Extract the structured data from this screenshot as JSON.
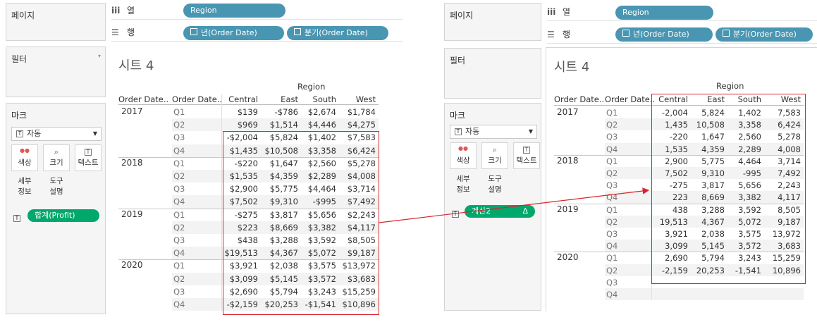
{
  "left": {
    "pages_label": "페이지",
    "filters_label": "필터",
    "marks_label": "마크",
    "columns_label": "열",
    "rows_label": "행",
    "columns_pill": "Region",
    "row_pills": [
      "년(Order Date)",
      "분기(Order Date)"
    ],
    "mark_type": "자동",
    "mark_buttons": [
      {
        "icon": "color-dots-icon",
        "label": "색상"
      },
      {
        "icon": "size-icon",
        "label": "크기"
      },
      {
        "icon": "text-icon",
        "label": "텍스트"
      },
      {
        "icon": "detail-icon",
        "label": "세부\n정보"
      },
      {
        "icon": "tooltip-icon",
        "label": "도구\n설명"
      }
    ],
    "mark_pill": "합계(Profit)",
    "sheet_title": "시트 4",
    "header": {
      "region": "Region",
      "col1": "Order Date..",
      "col2": "Order Date..",
      "regions": [
        "Central",
        "East",
        "South",
        "West"
      ]
    },
    "rows": [
      {
        "year": "2017",
        "q": "Q1",
        "v": [
          "$139",
          "-$786",
          "$2,674",
          "$1,784"
        ]
      },
      {
        "year": "",
        "q": "Q2",
        "v": [
          "$969",
          "$1,514",
          "$4,446",
          "$4,275"
        ]
      },
      {
        "year": "",
        "q": "Q3",
        "v": [
          "-$2,004",
          "$5,824",
          "$1,402",
          "$7,583"
        ]
      },
      {
        "year": "",
        "q": "Q4",
        "v": [
          "$1,435",
          "$10,508",
          "$3,358",
          "$6,424"
        ]
      },
      {
        "year": "2018",
        "q": "Q1",
        "v": [
          "-$220",
          "$1,647",
          "$2,560",
          "$5,278"
        ]
      },
      {
        "year": "",
        "q": "Q2",
        "v": [
          "$1,535",
          "$4,359",
          "$2,289",
          "$4,008"
        ]
      },
      {
        "year": "",
        "q": "Q3",
        "v": [
          "$2,900",
          "$5,775",
          "$4,464",
          "$3,714"
        ]
      },
      {
        "year": "",
        "q": "Q4",
        "v": [
          "$7,502",
          "$9,310",
          "-$995",
          "$7,492"
        ]
      },
      {
        "year": "2019",
        "q": "Q1",
        "v": [
          "-$275",
          "$3,817",
          "$5,656",
          "$2,243"
        ]
      },
      {
        "year": "",
        "q": "Q2",
        "v": [
          "$223",
          "$8,669",
          "$3,382",
          "$4,117"
        ]
      },
      {
        "year": "",
        "q": "Q3",
        "v": [
          "$438",
          "$3,288",
          "$3,592",
          "$8,505"
        ]
      },
      {
        "year": "",
        "q": "Q4",
        "v": [
          "$19,513",
          "$4,367",
          "$5,072",
          "$9,187"
        ]
      },
      {
        "year": "2020",
        "q": "Q1",
        "v": [
          "$3,921",
          "$2,038",
          "$3,575",
          "$13,972"
        ]
      },
      {
        "year": "",
        "q": "Q2",
        "v": [
          "$3,099",
          "$5,145",
          "$3,572",
          "$3,683"
        ]
      },
      {
        "year": "",
        "q": "Q3",
        "v": [
          "$2,690",
          "$5,794",
          "$3,243",
          "$15,259"
        ]
      },
      {
        "year": "",
        "q": "Q4",
        "v": [
          "-$2,159",
          "$20,253",
          "-$1,541",
          "$10,896"
        ]
      }
    ]
  },
  "right": {
    "pages_label": "페이지",
    "filters_label": "필터",
    "marks_label": "마크",
    "columns_label": "열",
    "rows_label": "행",
    "columns_pill": "Region",
    "row_pills": [
      "년(Order Date)",
      "분기(Order Date)"
    ],
    "mark_type": "자동",
    "mark_buttons": [
      {
        "icon": "color-dots-icon",
        "label": "색상"
      },
      {
        "icon": "size-icon",
        "label": "크기"
      },
      {
        "icon": "text-icon",
        "label": "텍스트"
      },
      {
        "icon": "detail-icon",
        "label": "세부\n정보"
      },
      {
        "icon": "tooltip-icon",
        "label": "도구\n설명"
      }
    ],
    "mark_pill": "계산2",
    "mark_pill_delta": "Δ",
    "sheet_title": "시트 4",
    "header": {
      "region": "Region",
      "col1": "Order Date..",
      "col2": "Order Date..",
      "regions": [
        "Central",
        "East",
        "South",
        "West"
      ]
    },
    "rows": [
      {
        "year": "2017",
        "q": "Q1",
        "v": [
          "-2,004",
          "5,824",
          "1,402",
          "7,583"
        ]
      },
      {
        "year": "",
        "q": "Q2",
        "v": [
          "1,435",
          "10,508",
          "3,358",
          "6,424"
        ]
      },
      {
        "year": "",
        "q": "Q3",
        "v": [
          "-220",
          "1,647",
          "2,560",
          "5,278"
        ]
      },
      {
        "year": "",
        "q": "Q4",
        "v": [
          "1,535",
          "4,359",
          "2,289",
          "4,008"
        ]
      },
      {
        "year": "2018",
        "q": "Q1",
        "v": [
          "2,900",
          "5,775",
          "4,464",
          "3,714"
        ]
      },
      {
        "year": "",
        "q": "Q2",
        "v": [
          "7,502",
          "9,310",
          "-995",
          "7,492"
        ]
      },
      {
        "year": "",
        "q": "Q3",
        "v": [
          "-275",
          "3,817",
          "5,656",
          "2,243"
        ]
      },
      {
        "year": "",
        "q": "Q4",
        "v": [
          "223",
          "8,669",
          "3,382",
          "4,117"
        ]
      },
      {
        "year": "2019",
        "q": "Q1",
        "v": [
          "438",
          "3,288",
          "3,592",
          "8,505"
        ]
      },
      {
        "year": "",
        "q": "Q2",
        "v": [
          "19,513",
          "4,367",
          "5,072",
          "9,187"
        ]
      },
      {
        "year": "",
        "q": "Q3",
        "v": [
          "3,921",
          "2,038",
          "3,575",
          "13,972"
        ]
      },
      {
        "year": "",
        "q": "Q4",
        "v": [
          "3,099",
          "5,145",
          "3,572",
          "3,683"
        ]
      },
      {
        "year": "2020",
        "q": "Q1",
        "v": [
          "2,690",
          "5,794",
          "3,243",
          "15,259"
        ]
      },
      {
        "year": "",
        "q": "Q2",
        "v": [
          "-2,159",
          "20,253",
          "-1,541",
          "10,896"
        ]
      },
      {
        "year": "",
        "q": "Q3",
        "v": [
          "",
          "",
          "",
          ""
        ]
      },
      {
        "year": "",
        "q": "Q4",
        "v": [
          "",
          "",
          "",
          ""
        ]
      }
    ]
  },
  "colors": {
    "pill_blue": "#4996b2",
    "pill_green": "#00a86b",
    "highlight_red": "#d9232e"
  }
}
